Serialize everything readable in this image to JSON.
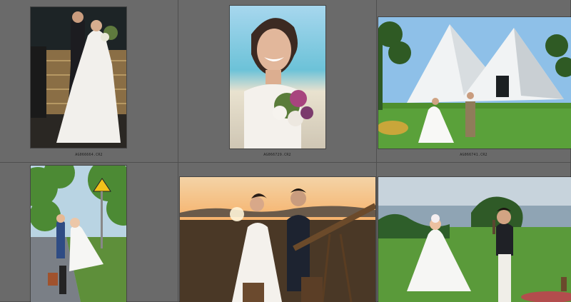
{
  "app": {
    "view": "grid"
  },
  "thumbnails": [
    {
      "filename": "AG066664.CR2",
      "subject": "bride-groom-dock-night",
      "selected": false
    },
    {
      "filename": "AG066729.CR2",
      "subject": "laughing-bride-bouquet",
      "selected": false
    },
    {
      "filename": "AG066741.CR2",
      "subject": "couple-modern-chapel-lawn",
      "selected": false
    },
    {
      "filename": "",
      "subject": "couple-street-sunny",
      "selected": false
    },
    {
      "filename": "",
      "subject": "couple-telescope-sunset",
      "selected": false
    },
    {
      "filename": "",
      "subject": "couple-seaside-lawn",
      "selected": false
    }
  ],
  "colors": {
    "panel_bg": "#5d5d5d",
    "cell_bg": "#6a6a6a",
    "label_text": "#1e1e1e"
  }
}
